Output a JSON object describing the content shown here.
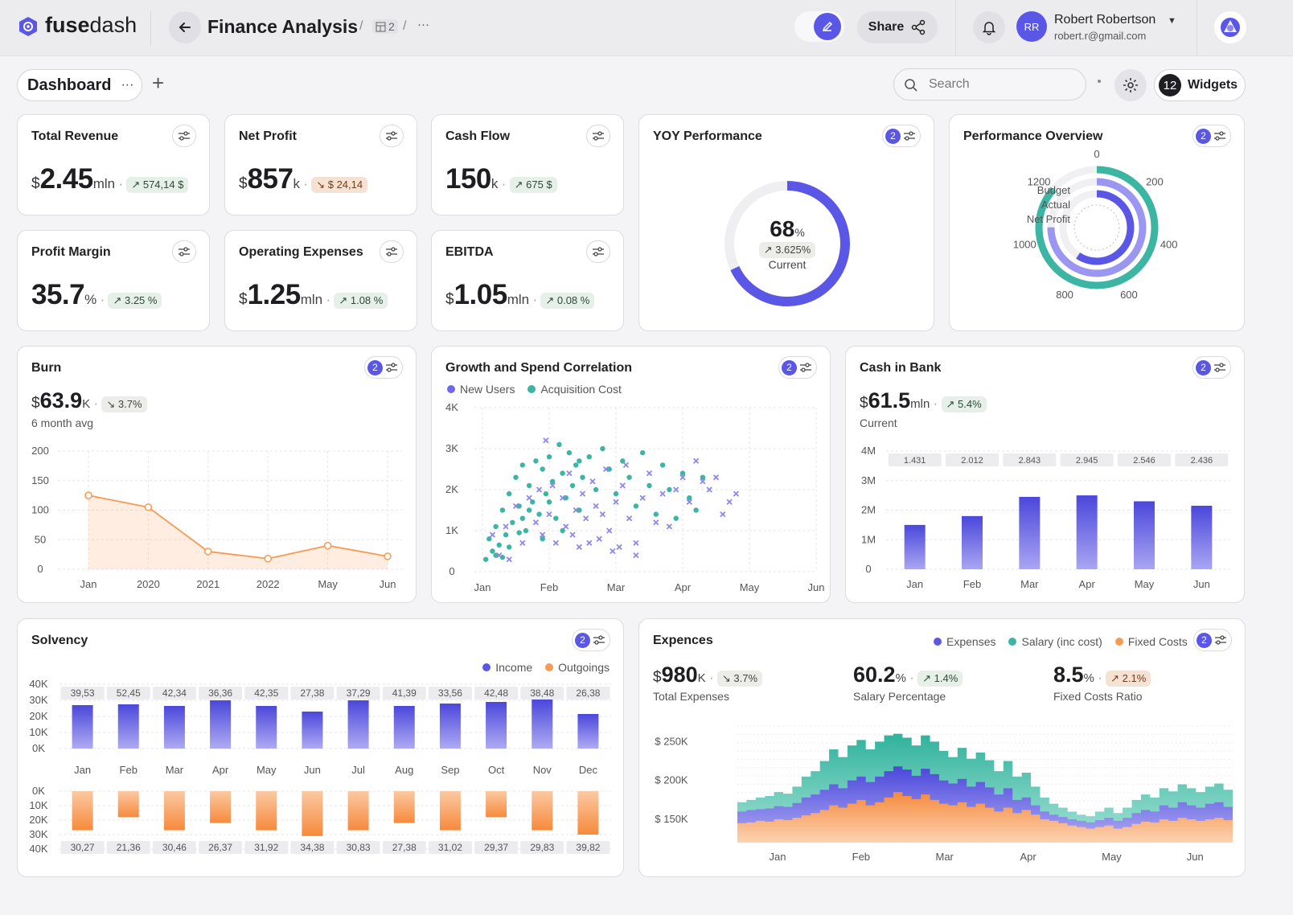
{
  "app": {
    "name_a": "fuse",
    "name_b": "dash",
    "page_title": "Finance Analysis",
    "crumb_count": "2",
    "crumb_more": "···",
    "share": "Share",
    "user_initials": "RR",
    "user_name": "Robert Robertson",
    "user_email": "robert.r@gmail.com"
  },
  "toolbar": {
    "tab": "Dashboard",
    "tab_more": "···",
    "add": "+",
    "search_placeholder": "Search",
    "widgets_count": "12",
    "widgets_label": "Widgets"
  },
  "kpis": [
    {
      "title": "Total Revenue",
      "cur": "$",
      "value": "2.45",
      "unit": "mln",
      "dot": "·",
      "delta": "↗ 574,14 $",
      "trend": "up"
    },
    {
      "title": "Net Profit",
      "cur": "$",
      "value": "857",
      "unit": "k",
      "dot": "·",
      "delta": "↘ $ 24,14",
      "trend": "down"
    },
    {
      "title": "Cash Flow",
      "cur": "",
      "value": "150",
      "unit": "k",
      "dot": "·",
      "delta": "↗ 675 $",
      "trend": "up"
    },
    {
      "title": "Profit Margin",
      "cur": "",
      "value": "35.7",
      "unit": "%",
      "dot": "·",
      "delta": "↗ 3.25 %",
      "trend": "up"
    },
    {
      "title": "Operating Expenses",
      "cur": "$",
      "value": "1.25",
      "unit": "mln",
      "dot": "·",
      "delta": "↗ 1.08 %",
      "trend": "up"
    },
    {
      "title": "EBITDA",
      "cur": "$",
      "value": "1.05",
      "unit": "mln",
      "dot": "·",
      "delta": "↗ 0.08 %",
      "trend": "up"
    }
  ],
  "yoy": {
    "title": "YOY Performance",
    "badge": "2",
    "value": "68",
    "unit": "%",
    "delta": "↗ 3.625%",
    "label": "Current",
    "percent": 68
  },
  "perf": {
    "title": "Performance Overview",
    "badge": "2",
    "legend": [
      "Budget",
      "Actual",
      "Net Profit"
    ],
    "ticks": [
      "0",
      "200",
      "400",
      "600",
      "800",
      "1000",
      "1200"
    ],
    "max": 1400,
    "values": {
      "Budget": 1210,
      "Actual": 1050,
      "Net Profit": 830
    },
    "colors": {
      "Budget": "#3cb5a3",
      "Actual": "#9b96f2",
      "Net Profit": "#5b57e6"
    }
  },
  "burn": {
    "title": "Burn",
    "badge": "2",
    "cur": "$",
    "value": "63.9",
    "unit": "K",
    "dot": "·",
    "delta": "↘ 3.7%",
    "sub": "6 month avg"
  },
  "growth": {
    "title": "Growth and Spend Correlation",
    "badge": "2",
    "legend": [
      "New Users",
      "Acquisition Cost"
    ]
  },
  "cash": {
    "title": "Cash in Bank",
    "badge": "2",
    "cur": "$",
    "value": "61.5",
    "unit": "mln",
    "dot": "·",
    "delta": "↗ 5.4%",
    "sub": "Current"
  },
  "solv": {
    "title": "Solvency",
    "badge": "2",
    "legend": [
      "Income",
      "Outgoings"
    ]
  },
  "exp": {
    "title": "Expences",
    "badge": "2",
    "legend": [
      "Expenses",
      "Salary (inc cost)",
      "Fixed Costs"
    ],
    "m1": {
      "cur": "$",
      "value": "980",
      "unit": "K",
      "dot": "·",
      "delta": "↘ 3.7%",
      "label": "Total Expenses"
    },
    "m2": {
      "value": "60.2",
      "unit": "%",
      "dot": "·",
      "delta": "↗ 1.4%",
      "label": "Salary Percentage"
    },
    "m3": {
      "value": "8.5",
      "unit": "%",
      "dot": "·",
      "delta": "↗ 2.1%",
      "label": "Fixed Costs Ratio"
    }
  },
  "colors": {
    "purple": "#5b57e6",
    "teal": "#3cb5a3",
    "orange": "#f79a52",
    "chip_up": "#e7efe9",
    "chip_down": "#f6e2d3"
  },
  "chart_data": [
    {
      "type": "line",
      "title": "Burn",
      "categories": [
        "Jan",
        "2020",
        "2021",
        "2022",
        "May",
        "Jun"
      ],
      "values": [
        125,
        105,
        30,
        18,
        40,
        22
      ],
      "ylim": [
        0,
        200
      ],
      "yticks": [
        "0",
        "50",
        "100",
        "150",
        "200"
      ],
      "color": "#f79a52"
    },
    {
      "type": "scatter",
      "title": "Growth and Spend Correlation",
      "xticks": [
        "Jan",
        "Feb",
        "Mar",
        "Apr",
        "May",
        "Jun"
      ],
      "xlim": [
        0,
        5
      ],
      "ylim": [
        0,
        4000
      ],
      "yticks": [
        "0",
        "1K",
        "2K",
        "3K",
        "4K"
      ],
      "series": [
        {
          "name": "New Users",
          "color": "#3cb5a3",
          "points": [
            [
              0.05,
              300
            ],
            [
              0.1,
              800
            ],
            [
              0.15,
              500
            ],
            [
              0.2,
              1100
            ],
            [
              0.25,
              650
            ],
            [
              0.3,
              1500
            ],
            [
              0.35,
              900
            ],
            [
              0.4,
              1900
            ],
            [
              0.45,
              1200
            ],
            [
              0.5,
              2300
            ],
            [
              0.55,
              1600
            ],
            [
              0.6,
              2600
            ],
            [
              0.65,
              1000
            ],
            [
              0.7,
              2100
            ],
            [
              0.75,
              1700
            ],
            [
              0.8,
              2700
            ],
            [
              0.85,
              1400
            ],
            [
              0.9,
              2500
            ],
            [
              0.95,
              1900
            ],
            [
              1.0,
              2800
            ],
            [
              1.05,
              2200
            ],
            [
              1.1,
              1300
            ],
            [
              1.15,
              3100
            ],
            [
              1.2,
              2400
            ],
            [
              1.25,
              1800
            ],
            [
              1.3,
              2900
            ],
            [
              1.35,
              2100
            ],
            [
              1.4,
              2600
            ],
            [
              1.45,
              1500
            ],
            [
              1.5,
              2300
            ],
            [
              1.6,
              2800
            ],
            [
              1.7,
              2000
            ],
            [
              1.8,
              3000
            ],
            [
              1.9,
              2500
            ],
            [
              2.0,
              1900
            ],
            [
              2.1,
              2700
            ],
            [
              2.2,
              2300
            ],
            [
              2.3,
              1600
            ],
            [
              2.4,
              2900
            ],
            [
              2.5,
              2100
            ],
            [
              2.6,
              1400
            ],
            [
              2.7,
              2600
            ],
            [
              2.8,
              2000
            ],
            [
              2.9,
              1300
            ],
            [
              3.0,
              2400
            ],
            [
              3.1,
              1800
            ],
            [
              3.2,
              1500
            ],
            [
              3.3,
              2300
            ],
            [
              0.3,
              350
            ],
            [
              0.6,
              1300
            ],
            [
              0.9,
              800
            ],
            [
              1.2,
              1000
            ],
            [
              0.4,
              600
            ],
            [
              0.7,
              1500
            ],
            [
              1.0,
              1700
            ],
            [
              0.2,
              400
            ],
            [
              0.55,
              950
            ],
            [
              1.45,
              2700
            ]
          ]
        },
        {
          "name": "Acquisition Cost",
          "color": "#8c88ee",
          "points": [
            [
              0.15,
              900
            ],
            [
              0.25,
              400
            ],
            [
              0.35,
              1100
            ],
            [
              0.4,
              300
            ],
            [
              0.5,
              1600
            ],
            [
              0.6,
              700
            ],
            [
              0.7,
              1800
            ],
            [
              0.8,
              1200
            ],
            [
              0.85,
              2000
            ],
            [
              0.9,
              900
            ],
            [
              0.95,
              3200
            ],
            [
              1.0,
              1400
            ],
            [
              1.05,
              2100
            ],
            [
              1.1,
              700
            ],
            [
              1.2,
              1800
            ],
            [
              1.25,
              1100
            ],
            [
              1.3,
              2400
            ],
            [
              1.35,
              900
            ],
            [
              1.4,
              1500
            ],
            [
              1.45,
              600
            ],
            [
              1.5,
              1900
            ],
            [
              1.55,
              1300
            ],
            [
              1.6,
              700
            ],
            [
              1.65,
              2200
            ],
            [
              1.7,
              1600
            ],
            [
              1.75,
              800
            ],
            [
              1.8,
              1400
            ],
            [
              1.85,
              2500
            ],
            [
              1.9,
              1000
            ],
            [
              2.0,
              1700
            ],
            [
              2.05,
              600
            ],
            [
              2.1,
              2100
            ],
            [
              2.2,
              1300
            ],
            [
              2.3,
              700
            ],
            [
              2.4,
              1800
            ],
            [
              2.5,
              2400
            ],
            [
              2.6,
              1200
            ],
            [
              2.7,
              1900
            ],
            [
              2.8,
              1100
            ],
            [
              2.9,
              2000
            ],
            [
              3.0,
              2300
            ],
            [
              3.1,
              1700
            ],
            [
              3.2,
              2700
            ],
            [
              3.3,
              2200
            ],
            [
              3.4,
              2000
            ],
            [
              3.5,
              2300
            ],
            [
              3.6,
              1400
            ],
            [
              3.7,
              1700
            ],
            [
              3.8,
              1900
            ],
            [
              2.15,
              2600
            ],
            [
              2.3,
              400
            ],
            [
              1.95,
              500
            ]
          ]
        }
      ]
    },
    {
      "type": "bar",
      "title": "Cash in Bank",
      "categories": [
        "Jan",
        "Feb",
        "Mar",
        "Apr",
        "May",
        "Jun"
      ],
      "values": [
        1.5,
        1.8,
        2.45,
        2.5,
        2.3,
        2.15
      ],
      "labels": [
        "1.431",
        "2.012",
        "2.843",
        "2.945",
        "2.546",
        "2.436"
      ],
      "ylim": [
        0,
        4
      ],
      "yticks": [
        "0",
        "1M",
        "2M",
        "3M",
        "4M"
      ],
      "color": "#5b57e6"
    },
    {
      "type": "bar",
      "title": "Solvency",
      "categories": [
        "Jan",
        "Feb",
        "Mar",
        "Apr",
        "May",
        "Jun",
        "Jul",
        "Aug",
        "Sep",
        "Oct",
        "Nov",
        "Dec"
      ],
      "series": [
        {
          "name": "Income",
          "color": "#5b57e6",
          "values": [
            27,
            27.5,
            26.5,
            30,
            26.5,
            23,
            30,
            26.5,
            28,
            29,
            30.5,
            21.5
          ],
          "labels": [
            "39,53",
            "52,45",
            "42,34",
            "36,36",
            "42,35",
            "27,38",
            "37,29",
            "41,39",
            "33,56",
            "42,48",
            "38,48",
            "26,38"
          ],
          "yticks": [
            "0K",
            "10K",
            "20K",
            "30K",
            "40K"
          ]
        },
        {
          "name": "Outgoings",
          "color": "#f79a52",
          "values": [
            27,
            18,
            27,
            22,
            27,
            31,
            27,
            22,
            27,
            18,
            27,
            30
          ],
          "labels": [
            "30,27",
            "21,36",
            "30,46",
            "26,37",
            "31,92",
            "34,38",
            "30,83",
            "27,38",
            "31,02",
            "29,37",
            "29,83",
            "39,82"
          ],
          "yticks": [
            "0K",
            "10K",
            "20K",
            "30K",
            "40K"
          ]
        }
      ],
      "ylim": [
        0,
        40
      ]
    },
    {
      "type": "area",
      "title": "Expences",
      "xticks": [
        "Jan",
        "Feb",
        "Mar",
        "Apr",
        "May",
        "Jun"
      ],
      "yticks": [
        "$ 150K",
        "$ 200K",
        "$ 250K"
      ],
      "ylim": [
        120,
        270
      ],
      "series": [
        {
          "name": "Fixed Costs",
          "color": "#f79a52",
          "values": [
            145,
            146,
            148,
            147,
            150,
            149,
            152,
            155,
            158,
            162,
            168,
            165,
            170,
            175,
            168,
            172,
            178,
            185,
            180,
            176,
            182,
            175,
            170,
            168,
            172,
            166,
            170,
            165,
            160,
            165,
            158,
            162,
            156,
            150,
            148,
            145,
            142,
            140,
            138,
            140,
            142,
            138,
            140,
            144,
            147,
            146,
            150,
            148,
            152,
            150,
            148,
            150,
            152,
            149
          ]
        },
        {
          "name": "Expenses",
          "color": "#6d69ea",
          "values": [
            160,
            162,
            163,
            164,
            167,
            166,
            171,
            178,
            182,
            188,
            195,
            190,
            200,
            205,
            198,
            205,
            212,
            218,
            214,
            206,
            215,
            208,
            200,
            196,
            202,
            192,
            198,
            191,
            182,
            190,
            175,
            178,
            168,
            160,
            156,
            153,
            150,
            148,
            146,
            149,
            152,
            148,
            152,
            158,
            162,
            160,
            168,
            165,
            172,
            168,
            165,
            170,
            172,
            166
          ]
        },
        {
          "name": "Salary (inc cost)",
          "color": "#44bfa8",
          "values": [
            172,
            175,
            178,
            180,
            185,
            183,
            192,
            205,
            212,
            225,
            240,
            230,
            245,
            252,
            240,
            250,
            258,
            260,
            255,
            245,
            258,
            250,
            238,
            230,
            242,
            228,
            236,
            226,
            212,
            225,
            205,
            210,
            192,
            178,
            170,
            165,
            160,
            156,
            154,
            160,
            165,
            158,
            165,
            175,
            182,
            178,
            190,
            186,
            195,
            190,
            185,
            192,
            196,
            188
          ]
        }
      ]
    }
  ]
}
